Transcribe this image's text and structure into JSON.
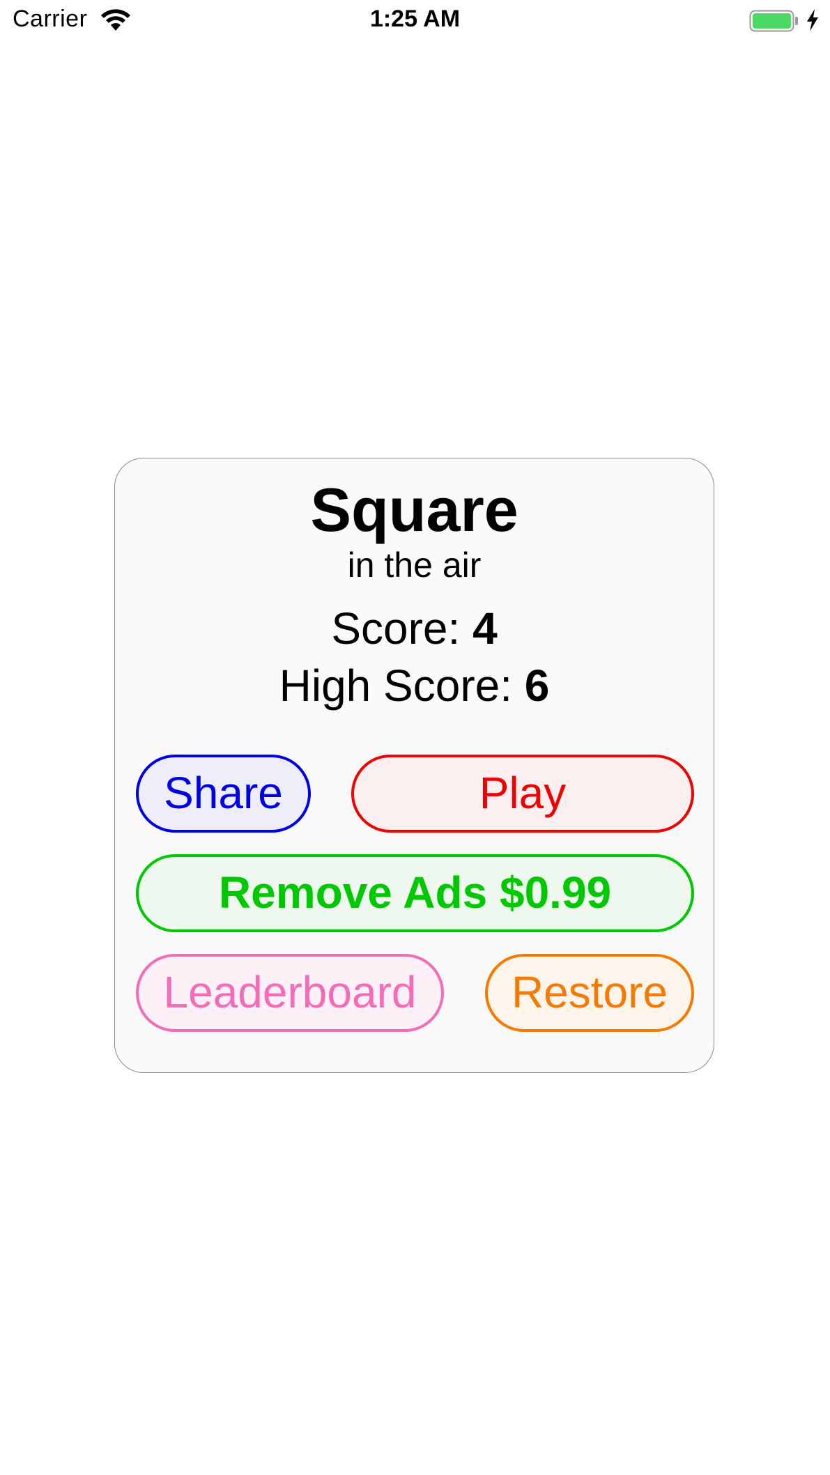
{
  "status_bar": {
    "carrier": "Carrier",
    "time": "1:25 AM",
    "icons": [
      "wifi-icon",
      "battery-icon",
      "charging-bolt-icon"
    ],
    "battery_color": "#4cd964"
  },
  "card": {
    "title": "Square",
    "subtitle": "in the air",
    "score_label": "Score:",
    "score_value": "4",
    "high_score_label": "High Score:",
    "high_score_value": "6"
  },
  "buttons": {
    "share": "Share",
    "play": "Play",
    "remove_ads": "Remove Ads $0.99",
    "leaderboard": "Leaderboard",
    "restore": "Restore"
  },
  "colors": {
    "share": "#0000e6",
    "play": "#f00000",
    "remove_ads": "#00c800",
    "leaderboard": "#f46cb7",
    "restore": "#f77a00"
  }
}
